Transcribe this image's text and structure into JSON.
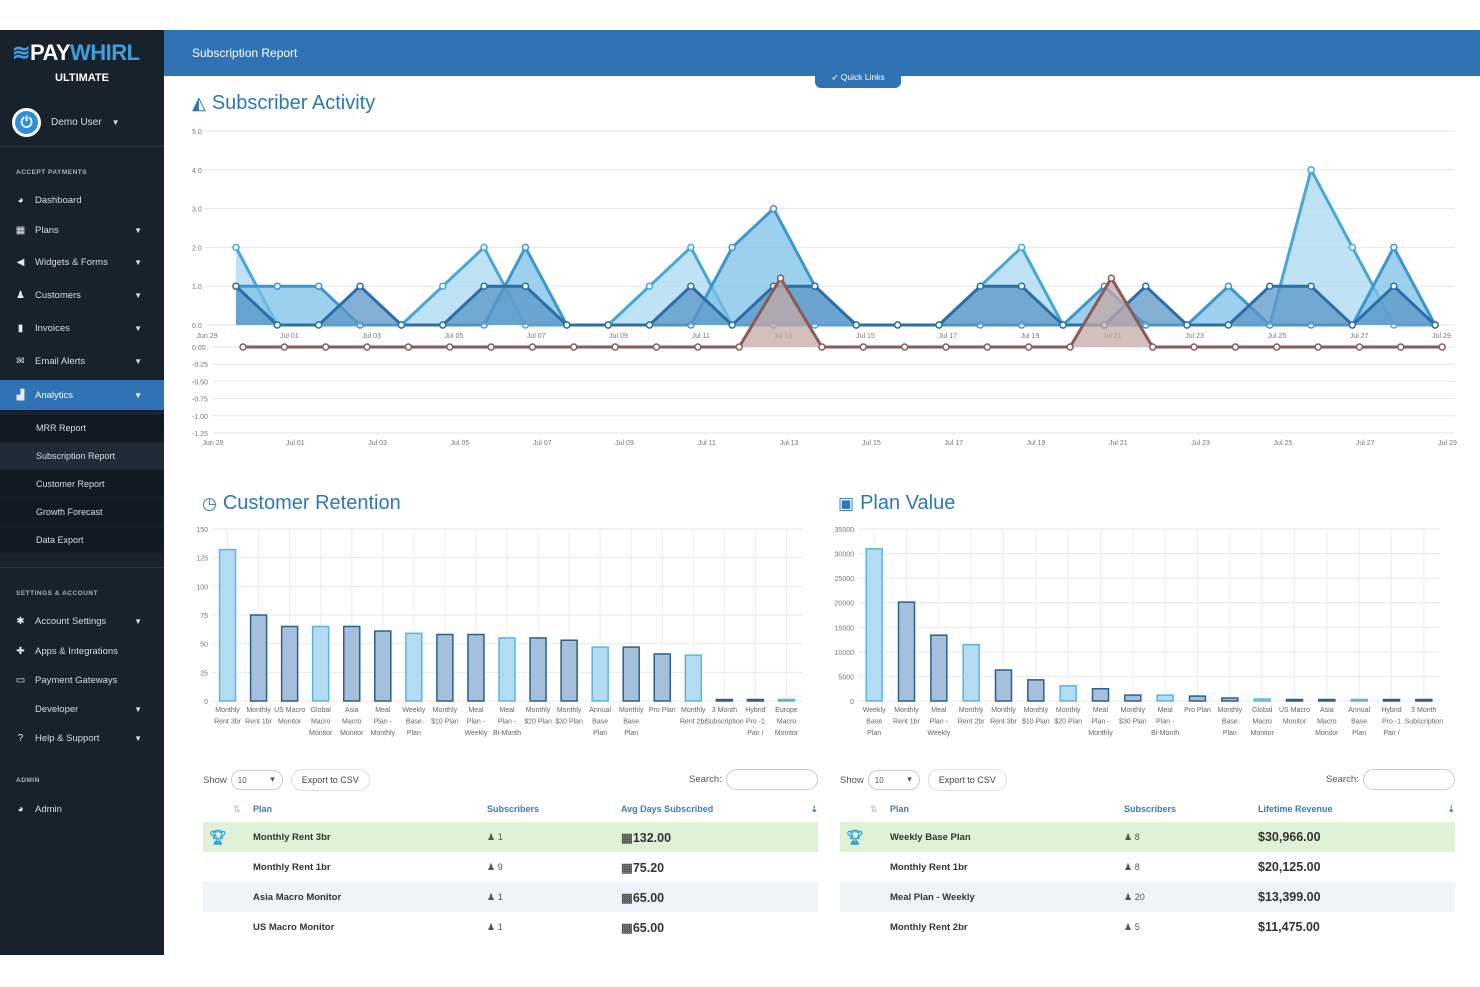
{
  "brand": {
    "name_a": "PAY",
    "name_b": "WHIRL",
    "tier": "ULTIMATE"
  },
  "user": {
    "name": "Demo User"
  },
  "sidebar": {
    "sections": [
      "ACCEPT PAYMENTS",
      "SETTINGS & ACCOUNT",
      "ADMIN"
    ],
    "items": [
      {
        "label": "Dashboard",
        "icon": "dashboard-icon",
        "chev": false
      },
      {
        "label": "Plans",
        "icon": "calendar-icon",
        "chev": true
      },
      {
        "label": "Widgets & Forms",
        "icon": "bullhorn-icon",
        "chev": true
      },
      {
        "label": "Customers",
        "icon": "users-icon",
        "chev": true
      },
      {
        "label": "Invoices",
        "icon": "file-icon",
        "chev": true
      },
      {
        "label": "Email Alerts",
        "icon": "envelope-icon",
        "chev": true
      },
      {
        "label": "Analytics",
        "icon": "bar-chart-icon",
        "chev": true,
        "active": true
      }
    ],
    "analytics_sub": [
      "MRR Report",
      "Subscription Report",
      "Customer Report",
      "Growth Forecast",
      "Data Export"
    ],
    "settings_items": [
      {
        "label": "Account Settings",
        "icon": "gear-icon",
        "chev": true
      },
      {
        "label": "Apps & Integrations",
        "icon": "puzzle-icon",
        "chev": false
      },
      {
        "label": "Payment Gateways",
        "icon": "credit-card-icon",
        "chev": false
      },
      {
        "label": "Developer",
        "icon": "code-icon",
        "chev": true
      },
      {
        "label": "Help & Support",
        "icon": "question-icon",
        "chev": true
      }
    ],
    "admin_items": [
      {
        "label": "Admin",
        "icon": "dashboard-icon",
        "chev": false
      }
    ]
  },
  "header": {
    "title": "Subscription Report",
    "quick_links": "Quick Links"
  },
  "colors": {
    "primary": "#2f73b5",
    "sidebar": "#17222d",
    "light_bar": "#b3dcf2",
    "dark_bar": "#a5c0da",
    "churn": "#8b5a55",
    "highlight_row": "#dff2d8"
  },
  "activity": {
    "title": "Subscriber Activity"
  },
  "retention": {
    "title": "Customer Retention"
  },
  "planvalue": {
    "title": "Plan Value"
  },
  "chart_data": [
    {
      "type": "area",
      "title": "Subscriber Activity",
      "panel": "upper",
      "ylim": [
        0,
        5
      ],
      "yticks": [
        "5.0",
        "4.0",
        "3.0",
        "2.0",
        "1.0",
        "0.0"
      ],
      "xticks": [
        "Jun 29",
        "Jul 01",
        "Jul 03",
        "Jul 05",
        "Jul 07",
        "Jul 09",
        "Jul 11",
        "Jul 13",
        "Jul 15",
        "Jul 17",
        "Jul 19",
        "Jul 21",
        "Jul 23",
        "Jul 25",
        "Jul 27",
        "Jul 29"
      ],
      "x_start": "Jun 30",
      "x_end": "Jul 29",
      "series": [
        {
          "color": "#45a8da",
          "fill": "#aad8f0",
          "values": [
            2,
            0,
            0,
            0,
            0,
            1,
            2,
            0,
            0,
            0,
            1,
            2,
            0,
            0,
            0,
            0,
            0,
            0,
            1,
            2,
            0,
            0,
            0,
            0,
            0,
            0,
            4,
            2,
            0,
            0
          ]
        },
        {
          "color": "#3c97cf",
          "fill": "#7cc0e6",
          "values": [
            1,
            1,
            1,
            0,
            0,
            0,
            0,
            2,
            0,
            0,
            0,
            0,
            2,
            3,
            1,
            0,
            0,
            0,
            0,
            0,
            0,
            1,
            0,
            0,
            1,
            0,
            0,
            0,
            2,
            0
          ]
        },
        {
          "color": "#2b6ea8",
          "fill": "#5a95c6",
          "values": [
            1,
            0,
            0,
            1,
            0,
            0,
            1,
            1,
            0,
            0,
            0,
            1,
            0,
            1,
            1,
            0,
            0,
            0,
            1,
            1,
            0,
            0,
            1,
            0,
            0,
            1,
            1,
            0,
            1,
            0
          ]
        }
      ]
    },
    {
      "type": "area",
      "panel": "lower",
      "ylim": [
        -1.25,
        0
      ],
      "yticks": [
        "0.00",
        "-0.25",
        "-0.50",
        "-0.75",
        "-1.00",
        "-1.25"
      ],
      "series": [
        {
          "color": "#8b5a55",
          "fill": "#c4a9a7",
          "values": [
            0,
            0,
            0,
            0,
            0,
            0,
            0,
            0,
            0,
            0,
            0,
            0,
            0,
            -1,
            0,
            0,
            0,
            0,
            0,
            0,
            0,
            -1,
            0,
            0,
            0,
            0,
            0,
            0,
            0,
            0
          ]
        }
      ]
    },
    {
      "type": "bar",
      "title": "Customer Retention",
      "ylim": [
        0,
        150
      ],
      "yticks": [
        150,
        125,
        100,
        75,
        50,
        25,
        0
      ],
      "categories": [
        "Monthly Rent 3br",
        "Monthly Rent 1br",
        "US Macro Monitor",
        "Global Macro Monitor",
        "Asia Macro Monitor",
        "Meal Plan - Monthly",
        "Weekly Base Plan",
        "Monthly $10 Plan",
        "Meal Plan - Weekly",
        "Meal Plan - Bi-Month",
        "Monthly $20 Plan",
        "Monthly $30 Plan",
        "Annual Base Plan",
        "Monthly Base Plan",
        "Pro Plan",
        "Monthly Rent 2br",
        "3 Month Subscription",
        "Hybrid Pro -1 Pair /",
        "Europe Macro Monitor"
      ],
      "values": [
        132,
        75,
        65,
        65,
        65,
        61,
        59,
        58,
        58,
        55,
        55,
        53,
        47,
        47,
        41,
        40,
        1,
        0.5,
        0.3
      ]
    },
    {
      "type": "bar",
      "title": "Plan Value",
      "ylim": [
        0,
        35000
      ],
      "yticks": [
        35000,
        30000,
        25000,
        20000,
        15000,
        10000,
        5000,
        0
      ],
      "categories": [
        "Weekly Base Plan",
        "Monthly Rent 1br",
        "Meal Plan - Weekly",
        "Monthly Rent 2br",
        "Monthly Rent 3br",
        "Monthly $10 Plan",
        "Monthly $20 Plan",
        "Meal Plan - Monthly",
        "Monthly $30 Plan",
        "Meal Plan - Bi-Month",
        "Pro Plan",
        "Monthly Base Plan",
        "Global Macro Monitor",
        "US Macro Monitor",
        "Asia Macro Monitor",
        "Annual Base Plan",
        "Hybrid Pro -1 Pair /",
        "3 Month Subscription"
      ],
      "values": [
        30966,
        20125,
        13399,
        11475,
        6300,
        4300,
        3100,
        2500,
        1200,
        1200,
        1000,
        600,
        400,
        300,
        200,
        150,
        150,
        100
      ]
    }
  ],
  "table_controls": {
    "show": "Show",
    "page_size": "10",
    "export": "Export to CSV",
    "search": "Search:"
  },
  "retention_table": {
    "headers": [
      "Plan",
      "Subscribers",
      "Avg Days Subscribed"
    ],
    "rows": [
      [
        "Monthly Rent 3br",
        "1",
        "132.00"
      ],
      [
        "Monthly Rent 1br",
        "9",
        "75.20"
      ],
      [
        "Asia Macro Monitor",
        "1",
        "65.00"
      ],
      [
        "US Macro Monitor",
        "1",
        "65.00"
      ]
    ]
  },
  "value_table": {
    "headers": [
      "Plan",
      "Subscribers",
      "Lifetime Revenue"
    ],
    "rows": [
      [
        "Weekly Base Plan",
        "8",
        "$30,966.00"
      ],
      [
        "Monthly Rent 1br",
        "8",
        "$20,125.00"
      ],
      [
        "Meal Plan - Weekly",
        "20",
        "$13,399.00"
      ],
      [
        "Monthly Rent 2br",
        "5",
        "$11,475.00"
      ]
    ]
  }
}
